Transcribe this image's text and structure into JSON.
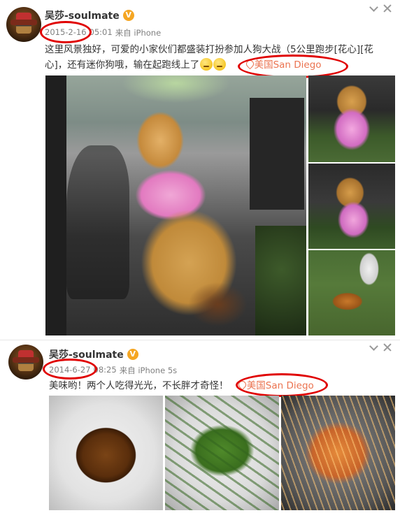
{
  "posts": [
    {
      "username": "吴莎-soulmate",
      "verified_badge": "V",
      "date": "2015-2-16",
      "time": "05:01",
      "source": "来自 iPhone",
      "text_part1": "这里风景独好，可爱的小家伙们都盛装打扮参加人狗大战（5公里跑步[花心][花心]，还有迷你狗哦，输在起跑线上了",
      "location": "美国San Diego",
      "icons": [
        "chevron-down-icon",
        "close-icon",
        "location-pin-icon",
        "emoji-icon"
      ]
    },
    {
      "username": "吴莎-soulmate",
      "verified_badge": "V",
      "date": "2014-6-27",
      "time": "08:25",
      "source": "来自 iPhone 5s",
      "text_part1": "美味哟！两个人吃得光光，不长胖才奇怪！",
      "location": "美国San Diego",
      "icons": [
        "chevron-down-icon",
        "close-icon",
        "location-pin-icon"
      ]
    }
  ],
  "colors": {
    "location": "#eb7350",
    "annotation": "#e00000",
    "badge": "#f5a623"
  }
}
